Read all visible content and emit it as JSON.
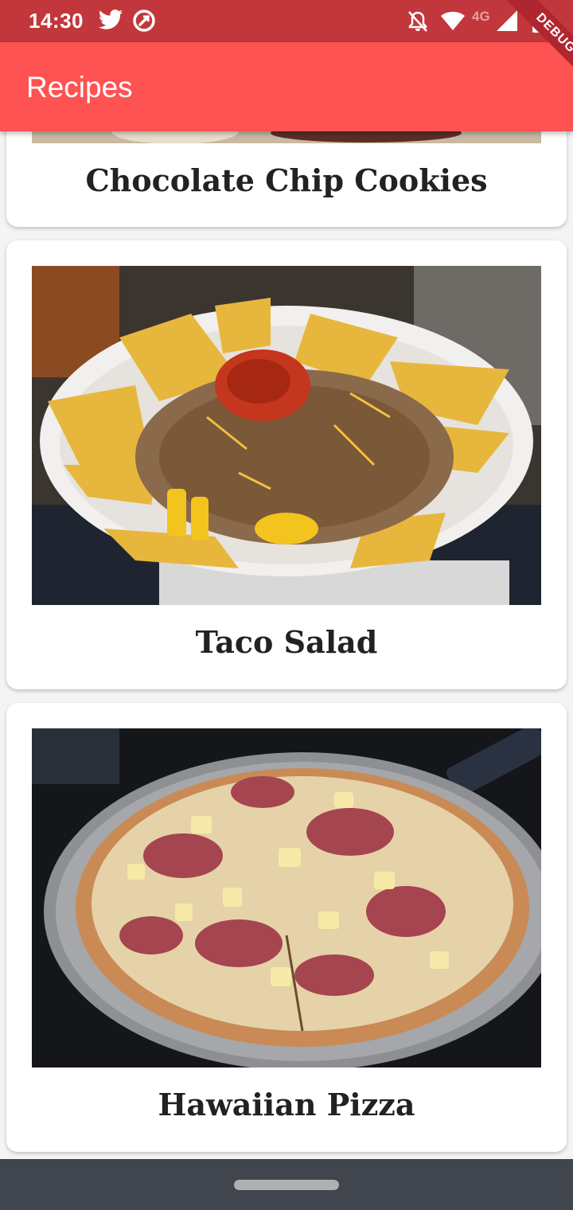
{
  "status_bar": {
    "time": "14:30",
    "network_label": "4G",
    "icons": [
      "twitter-icon",
      "sync-icon",
      "notifications-off-icon",
      "wifi-icon",
      "cell-signal-icon",
      "battery-charging-icon"
    ]
  },
  "app_bar": {
    "title": "Recipes",
    "debug_label": "DEBUG",
    "color": "#ff5252"
  },
  "recipes": [
    {
      "title": "Chocolate Chip Cookies",
      "image": "cookies-photo"
    },
    {
      "title": "Taco Salad",
      "image": "taco-salad-photo"
    },
    {
      "title": "Hawaiian Pizza",
      "image": "hawaiian-pizza-photo"
    }
  ]
}
